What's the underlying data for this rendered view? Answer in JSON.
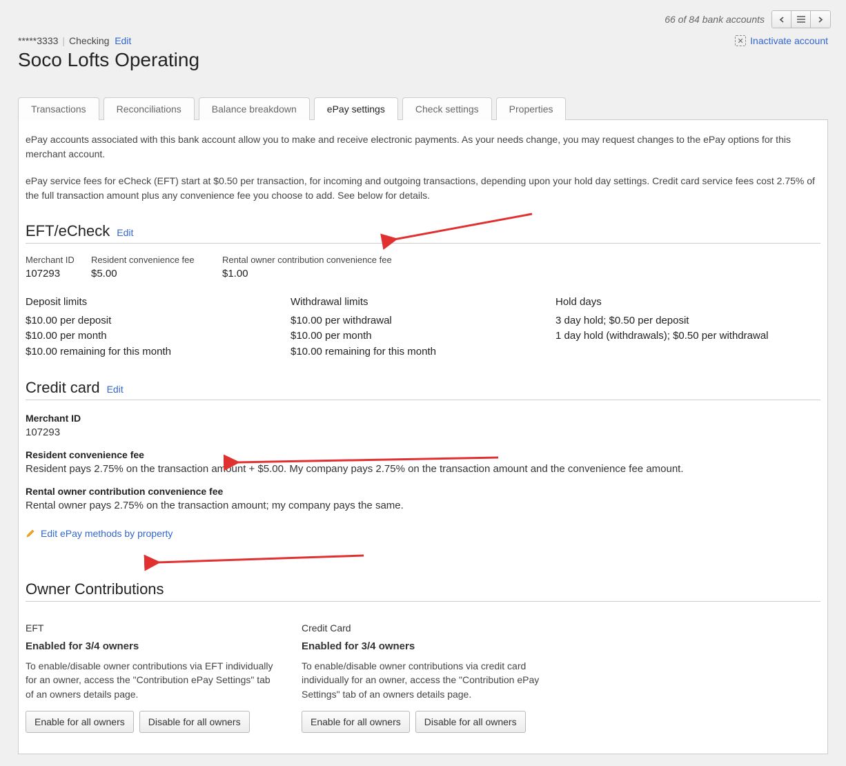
{
  "pager": {
    "text": "66 of 84 bank accounts"
  },
  "header": {
    "masked_number": "*****3333",
    "account_type": "Checking",
    "edit_label": "Edit",
    "inactivate_label": "Inactivate account",
    "title": "Soco Lofts Operating"
  },
  "tabs": [
    {
      "label": "Transactions"
    },
    {
      "label": "Reconciliations"
    },
    {
      "label": "Balance breakdown"
    },
    {
      "label": "ePay settings",
      "active": true
    },
    {
      "label": "Check settings"
    },
    {
      "label": "Properties"
    }
  ],
  "intro": {
    "p1": "ePay accounts associated with this bank account allow you to make and receive electronic payments. As your needs change, you may request changes to the ePay options for this merchant account.",
    "p2": "ePay service fees for eCheck (EFT) start at $0.50 per transaction, for incoming and outgoing transactions, depending upon your hold day settings. Credit card service fees cost 2.75% of the full transaction amount plus any convenience fee you choose to add. See below for details."
  },
  "eft": {
    "heading": "EFT/eCheck",
    "edit_label": "Edit",
    "merchant_id_label": "Merchant ID",
    "merchant_id": "107293",
    "resident_fee_label": "Resident convenience fee",
    "resident_fee": "$5.00",
    "rental_owner_fee_label": "Rental owner contribution convenience fee",
    "rental_owner_fee": "$1.00",
    "deposit_limits_label": "Deposit limits",
    "deposit_limits": [
      "$10.00 per deposit",
      "$10.00 per month",
      "$10.00 remaining for this month"
    ],
    "withdrawal_limits_label": "Withdrawal limits",
    "withdrawal_limits": [
      "$10.00 per withdrawal",
      "$10.00 per month",
      "$10.00 remaining for this month"
    ],
    "hold_days_label": "Hold days",
    "hold_days": [
      "3 day hold; $0.50 per deposit",
      "1 day hold (withdrawals); $0.50 per withdrawal"
    ]
  },
  "credit_card": {
    "heading": "Credit card",
    "edit_label": "Edit",
    "merchant_id_label": "Merchant ID",
    "merchant_id": "107293",
    "resident_fee_label": "Resident convenience fee",
    "resident_fee_desc": "Resident pays 2.75% on the transaction amount + $5.00. My company pays 2.75% on the transaction amount and the convenience fee amount.",
    "rental_owner_fee_label": "Rental owner contribution convenience fee",
    "rental_owner_fee_desc": "Rental owner pays 2.75% on the transaction amount; my company pays the same."
  },
  "edit_methods_label": "Edit ePay methods by property",
  "owner_contrib": {
    "heading": "Owner Contributions",
    "eft": {
      "title": "EFT",
      "enabled": "Enabled for 3/4 owners",
      "desc": "To enable/disable owner contributions via EFT individually for an owner, access the \"Contribution ePay Settings\" tab of an owners details page.",
      "enable_btn": "Enable for all owners",
      "disable_btn": "Disable for all owners"
    },
    "cc": {
      "title": "Credit Card",
      "enabled": "Enabled for 3/4 owners",
      "desc": "To enable/disable owner contributions via credit card individually for an owner, access the \"Contribution ePay Settings\" tab of an owners details page.",
      "enable_btn": "Enable for all owners",
      "disable_btn": "Disable for all owners"
    }
  }
}
